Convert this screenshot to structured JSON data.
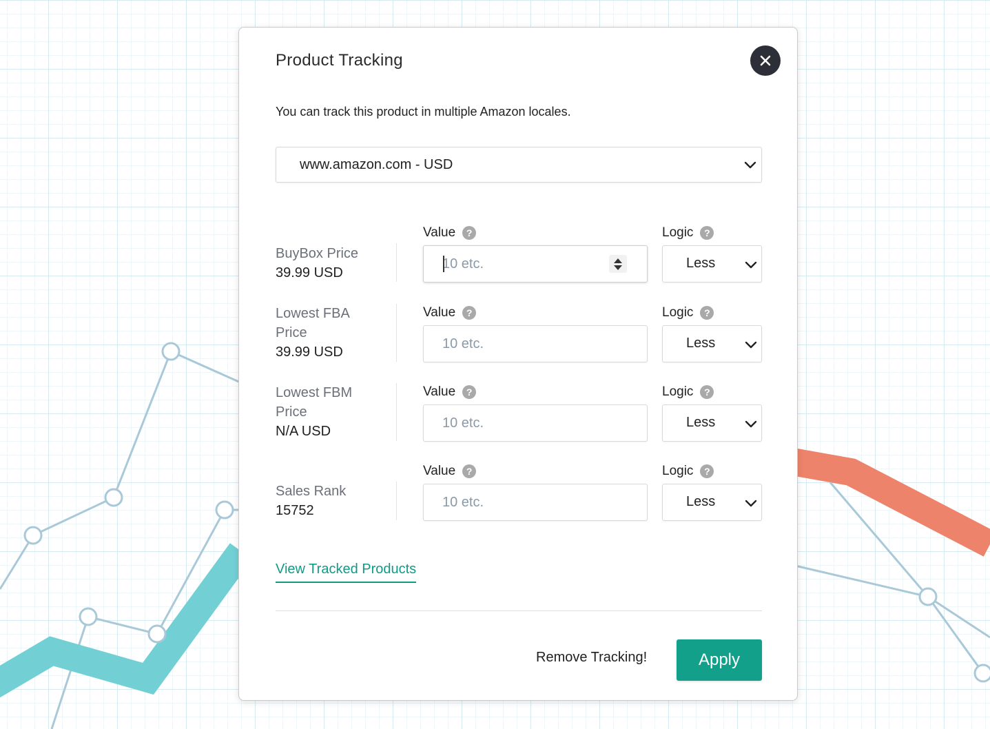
{
  "modal": {
    "title": "Product Tracking",
    "subtitle": "You can track this product in multiple Amazon locales.",
    "locale_selected": "www.amazon.com - USD"
  },
  "columns": {
    "value_header": "Value",
    "logic_header": "Logic",
    "help_glyph": "?"
  },
  "rows": [
    {
      "label_line1": "BuyBox Price",
      "label_line2": "",
      "amount": "39.99 USD",
      "value_placeholder": "10 etc.",
      "logic": "Less"
    },
    {
      "label_line1": "Lowest FBA",
      "label_line2": "Price",
      "amount": "39.99 USD",
      "value_placeholder": "10 etc.",
      "logic": "Less"
    },
    {
      "label_line1": "Lowest FBM",
      "label_line2": "Price",
      "amount": "N/A USD",
      "value_placeholder": "10 etc.",
      "logic": "Less"
    },
    {
      "label_line1": "Sales Rank",
      "label_line2": "",
      "amount": "15752",
      "value_placeholder": "10 etc.",
      "logic": "Less"
    }
  ],
  "links": {
    "view_tracked": "View Tracked Products"
  },
  "footer": {
    "remove_label": "Remove Tracking!",
    "apply_label": "Apply"
  },
  "icons": {
    "close": "close-icon",
    "dropdown": "chevron-down-icon",
    "help": "help-icon",
    "spinner": "number-spinner-icon"
  },
  "colors": {
    "accent": "#12a08a",
    "link": "#0f9b86",
    "close_button": "#2c2f38",
    "chart_teal": "#72d0d4",
    "chart_coral": "#ee836b",
    "chart_line": "#a9c8d8"
  }
}
